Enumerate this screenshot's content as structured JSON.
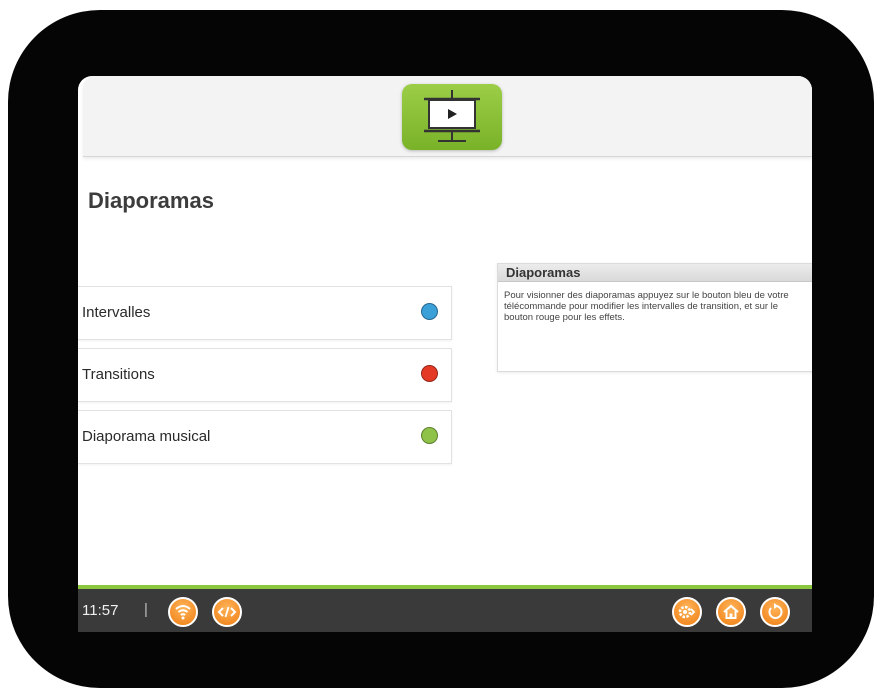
{
  "page_title": "Diaporamas",
  "menu": {
    "items": [
      {
        "label": "Intervalles",
        "color": "#3b9fd8",
        "color_name": "blue"
      },
      {
        "label": "Transitions",
        "color": "#e43a25",
        "color_name": "red"
      },
      {
        "label": "Diaporama musical",
        "color": "#8fc249",
        "color_name": "green"
      }
    ]
  },
  "info": {
    "title": "Diaporamas",
    "text": "Pour visionner des diaporamas appuyez sur le bouton bleu de votre télécommande pour modifier les intervalles de transition, et sur le bouton rouge pour les effets."
  },
  "status": {
    "time": "11:57",
    "separator": "|"
  },
  "icons": {
    "app": "slideshow-projector-icon",
    "status_left": [
      "wifi-icon",
      "code-icon"
    ],
    "status_right": [
      "settings-icon",
      "home-icon",
      "back-icon"
    ]
  },
  "colors": {
    "accent_green": "#8bc63f",
    "bottom_bar": "#3a3a3a",
    "orange_buttons": "#ee7d12"
  }
}
